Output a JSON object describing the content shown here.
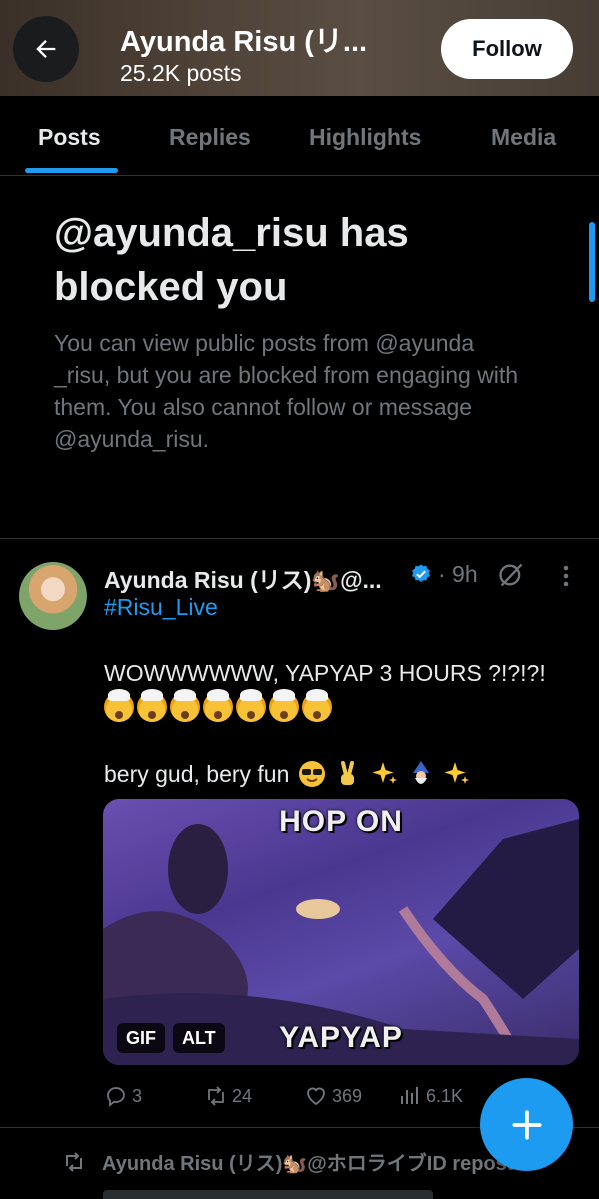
{
  "header": {
    "name": "Ayunda Risu (リ...",
    "post_count": "25.2K posts",
    "follow_label": "Follow"
  },
  "tabs": [
    {
      "label": "Posts",
      "active": true
    },
    {
      "label": "Replies",
      "active": false
    },
    {
      "label": "Highlights",
      "active": false
    },
    {
      "label": "Media",
      "active": false
    }
  ],
  "blocked": {
    "title": "@ayunda_risu has blocked you",
    "description": "You can view public posts from @ayunda _risu, but you are blocked from engaging with them. You also cannot follow or message @ayunda_risu."
  },
  "post": {
    "author": "Ayunda Risu (リス)🐿️@...",
    "time": "· 9h",
    "hashtag": "#Risu_Live",
    "line1": "WOWWWWWW, YAPYAP 3 HOURS ?!?!?!",
    "emoji_count": 7,
    "line2": "bery gud, bery fun",
    "media": {
      "caption_top": "HOP ON",
      "caption_bottom": "YAPYAP",
      "badge_gif": "GIF",
      "badge_alt": "ALT"
    },
    "actions": {
      "replies": "3",
      "reposts": "24",
      "likes": "369",
      "views": "6.1K"
    }
  },
  "repost_notice": "Ayunda Risu (リス)🐿️@ホロライブID reposted",
  "colors": {
    "accent": "#1d9bf0",
    "secondary_text": "#71767b",
    "background": "#000000"
  }
}
